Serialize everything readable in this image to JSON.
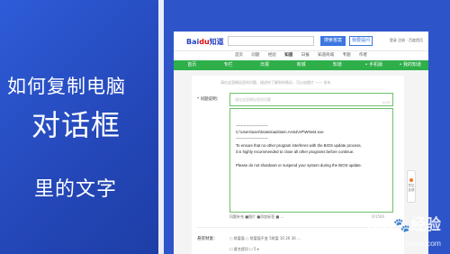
{
  "promo": {
    "line1": "如何复制电脑",
    "line2": "对话框",
    "line3": "里的文字"
  },
  "site": {
    "logo_blue": "Bai",
    "logo_red": "du",
    "logo_suffix": "知道",
    "ask_button": "搜索答案",
    "answer_button": "我要提问",
    "top_links": "登录 注册 · 百度首页"
  },
  "tabs": [
    "首页",
    "问题",
    "经验",
    "知道",
    "日报",
    "知道商城",
    "专题",
    "作者"
  ],
  "greenbar": [
    "首页",
    "专栏",
    "日报",
    "商城",
    "知道",
    "• 手机版",
    "• 我的知道"
  ],
  "form": {
    "tip": "请在这里概括您的问题，描述你了解到的情况，可以加图片 —— 发布",
    "question_label": "* 问题说明：",
    "question_placeholder": "请在这里概括您的问题",
    "question_count": "0/30",
    "editor_lines": [
      "-------------------------",
      "C:\\Users\\user\\Downloads\\wm.AA64\\AP\\WNet4.exe",
      "-------------------------",
      "To ensure that no other program interferes with the BIOS update process,",
      "it is highly recommended to close all other programs before continue.",
      "",
      "Please do not shutdown or suspend your system during the BIOS update."
    ],
    "tools": "问题补充  ■图片  ■添加标签  ■ ...",
    "tools_count": "0/1500",
    "reward_label": "悬赏财富：",
    "reward_text": "○ 财富值  ○ 财富值不变  5财富 10 20 30  ...",
    "anonymous": "☐ 匿名提问  ☐ 5 ▾"
  },
  "side_widget": "意见反馈",
  "watermark": {
    "brand": "Bai",
    "brand2": "经验",
    "url": "jingyan.baidu.com"
  }
}
